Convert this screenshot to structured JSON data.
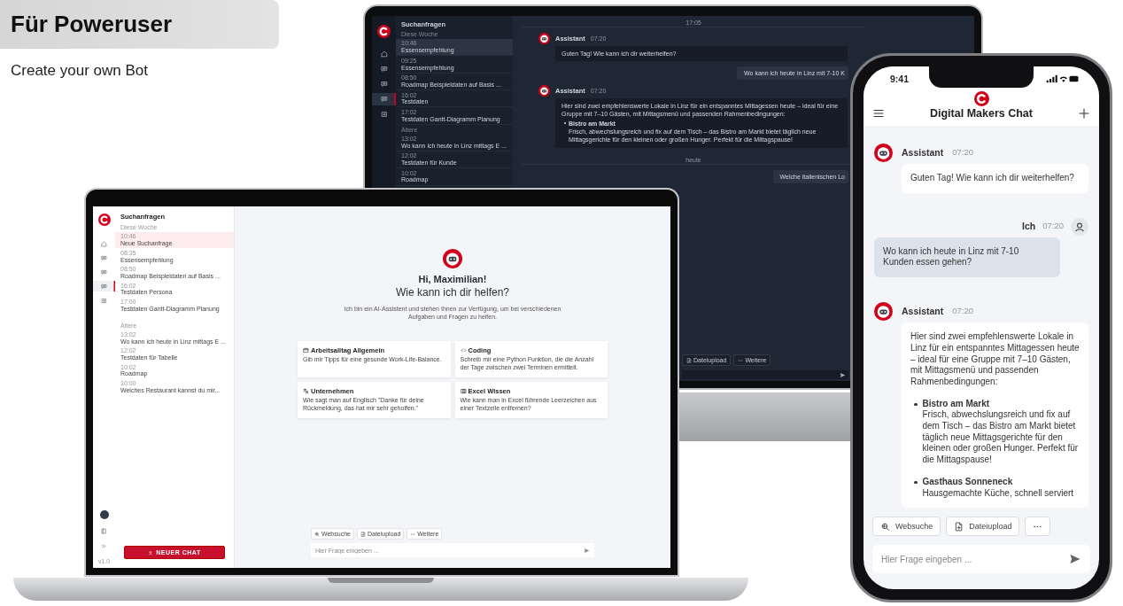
{
  "header": {
    "title": "Für Poweruser",
    "subtitle": "Create your own Bot"
  },
  "monitor": {
    "rail": [
      {
        "kind": "home",
        "selected": false
      },
      {
        "kind": "chat",
        "selected": false
      },
      {
        "kind": "chat",
        "selected": false
      },
      {
        "kind": "chat",
        "selected": true
      },
      {
        "kind": "add",
        "selected": false
      }
    ],
    "sidebar": {
      "title": "Suchanfragen",
      "groups": [
        {
          "label": "Diese Woche",
          "items": [
            {
              "time": "10:46",
              "title": "Essensempfehlung",
              "selected": true
            },
            {
              "time": "09:25",
              "title": "Essensempfehlung",
              "selected": false
            },
            {
              "time": "08:50",
              "title": "Roadmap Beispieldaten auf Basis ...",
              "selected": false
            },
            {
              "time": "16:02",
              "title": "Testdaten",
              "selected": false
            },
            {
              "time": "17:02",
              "title": "Testdaten Gantt-Diagramm Planung",
              "selected": false
            }
          ]
        },
        {
          "label": "Ältere",
          "items": [
            {
              "time": "13:02",
              "title": "Wo kann ich heute in Linz mittags E ...",
              "selected": false
            },
            {
              "time": "12:02",
              "title": "Testdaten für Kunde",
              "selected": false
            },
            {
              "time": "10:02",
              "title": "Roadmap",
              "selected": false
            }
          ]
        }
      ]
    },
    "chat": {
      "items": [
        {
          "kind": "divider",
          "text": "17:05"
        },
        {
          "kind": "assistant",
          "author": "Assistant",
          "time": "07:20",
          "text": "Guten Tag! Wie kann ich dir weiterhelfen?"
        },
        {
          "kind": "user",
          "text": "Wo kann ich heute in Linz mit 7-10 K"
        },
        {
          "kind": "assistant",
          "author": "Assistant",
          "time": "07:20",
          "text": "Hier sind zwei empfehlenswerte Lokale in Linz für ein entspanntes Mittagessen heute – ideal für eine Gruppe mit 7–10 Gästen, mit Mittagsmenü und passenden Rahmenbedingungen:",
          "bullets": [
            {
              "title": "Bistro am Markt",
              "text": "Frisch, abwechslungsreich und fix auf dem Tisch – das Bistro am Markt bietet täglich neue Mittagsgerichte für den kleinen oder großen Hunger. Perfekt für die Mittagspause!"
            }
          ]
        },
        {
          "kind": "divider",
          "text": "heute"
        },
        {
          "kind": "user",
          "text": "Welche italienischen Lo"
        }
      ],
      "tools": [
        {
          "kind": "file",
          "label": "Dateiupload"
        },
        {
          "kind": "more",
          "label": "Weitere"
        }
      ]
    }
  },
  "laptop": {
    "rail": [
      {
        "kind": "home",
        "selected": false
      },
      {
        "kind": "chat",
        "selected": false
      },
      {
        "kind": "chat",
        "selected": false
      },
      {
        "kind": "chat",
        "selected": true
      },
      {
        "kind": "add",
        "selected": false
      }
    ],
    "version": "v1.0",
    "sidebar": {
      "title": "Suchanfragen",
      "groups": [
        {
          "label": "Diese Woche",
          "items": [
            {
              "time": "10:46",
              "title": "Neue Suchanfrage",
              "selected": true
            },
            {
              "time": "08:35",
              "title": "Essensempfehlung",
              "selected": false
            },
            {
              "time": "08:50",
              "title": "Roadmap Beispieldaten auf Basis ...",
              "selected": false
            },
            {
              "time": "16:02",
              "title": "Testdaten Persona",
              "selected": false
            },
            {
              "time": "17:00",
              "title": "Testdaten Gantt-Diagramm Planung",
              "selected": false
            }
          ]
        },
        {
          "label": "Ältere",
          "items": [
            {
              "time": "13:02",
              "title": "Wo kann ich heute in Linz mittags E ...",
              "selected": false
            },
            {
              "time": "12:02",
              "title": "Testdaten für Tabelle",
              "selected": false
            },
            {
              "time": "10:02",
              "title": "Roadmap",
              "selected": false
            },
            {
              "time": "10:00",
              "title": "Welches Restaurant kannst du mir...",
              "selected": false
            }
          ]
        }
      ]
    },
    "new_chat": "NEUER CHAT",
    "welcome": {
      "greeting": "Hi, Maximilian!",
      "question": "Wie kann ich dir helfen?",
      "intro": "Ich bin ein AI-Assistent und stehen Ihnen zur Verfügung, um bei verschiedenen Aufgaben und Fragen zu helfen."
    },
    "cards": [
      {
        "kind": "calendar",
        "title": "Arbeitsalltag Allgemein",
        "text": "Gib mir Tipps für eine gesunde Work-Life-Balance."
      },
      {
        "kind": "code",
        "title": "Coding",
        "text": "Schreib mir eine Python Funktion, die die Anzahl der Tage zwischen zwei Terminen ermittelt."
      },
      {
        "kind": "translate",
        "title": "Unternehmen",
        "text": "Wie sagt man auf Englisch \"Danke für deine Rückmeldung, das hat mir sehr geholfen.\""
      },
      {
        "kind": "table",
        "title": "Excel Wissen",
        "text": "Wie kann man in Excel führende Leerzeichen aus einer Textzeile entfernen?"
      }
    ],
    "tools": [
      {
        "kind": "search",
        "label": "Websuche"
      },
      {
        "kind": "file",
        "label": "Dateiupload"
      },
      {
        "kind": "more",
        "label": "Weitere"
      }
    ],
    "input": {
      "placeholder": "Hier Frage eingeben ..."
    }
  },
  "phone": {
    "time": "9:41",
    "title": "Digital Makers Chat",
    "messages": [
      {
        "kind": "assistant",
        "author": "Assistant",
        "time": "07:20",
        "text": "Guten Tag! Wie kann ich dir weiterhelfen?"
      },
      {
        "kind": "user",
        "author": "Ich",
        "time": "07:20",
        "text": "Wo kann ich heute in Linz mit 7-10 Kunden essen gehen?"
      },
      {
        "kind": "assistant",
        "author": "Assistant",
        "time": "07:20",
        "text": "Hier sind zwei empfehlenswerte Lokale in Linz für ein entspanntes Mittagessen heute – ideal für eine Gruppe mit 7–10 Gästen, mit Mittagsmenü und passenden Rahmenbedingungen:",
        "bullets": [
          {
            "title": "Bistro am Markt",
            "text": "Frisch, abwechslungsreich und fix auf dem Tisch – das Bistro am Markt bietet täglich neue Mittagsgerichte für den kleinen oder großen Hunger. Perfekt für die Mittagspause!"
          },
          {
            "title": "Gasthaus Sonneneck",
            "text": "Hausgemachte Küche, schnell serviert"
          }
        ]
      }
    ],
    "tools": [
      {
        "kind": "search",
        "label": "Websuche"
      },
      {
        "kind": "file",
        "label": "Dateiupload"
      },
      {
        "kind": "more"
      }
    ],
    "input": {
      "placeholder": "Hier Frage eingeben ..."
    }
  }
}
